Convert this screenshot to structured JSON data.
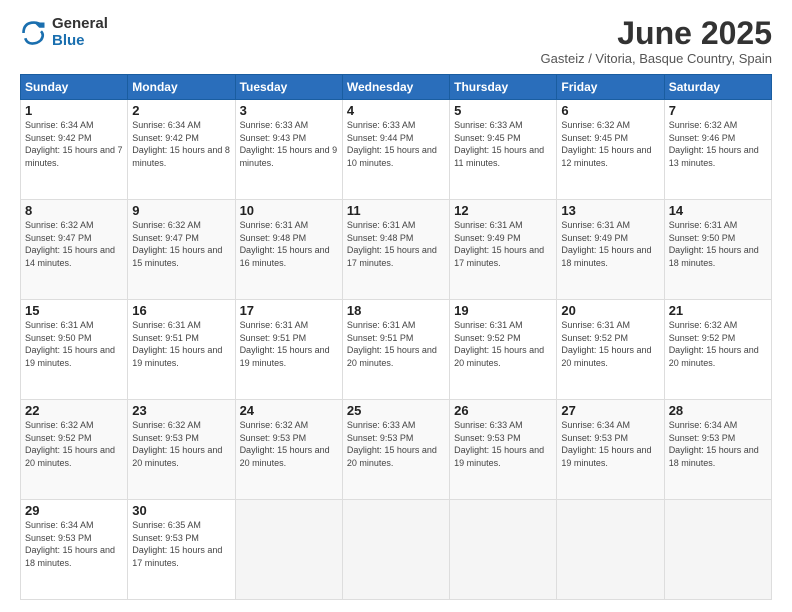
{
  "logo": {
    "general": "General",
    "blue": "Blue"
  },
  "title": {
    "month": "June 2025",
    "location": "Gasteiz / Vitoria, Basque Country, Spain"
  },
  "days_of_week": [
    "Sunday",
    "Monday",
    "Tuesday",
    "Wednesday",
    "Thursday",
    "Friday",
    "Saturday"
  ],
  "weeks": [
    [
      {
        "day": "1",
        "sunrise": "6:34 AM",
        "sunset": "9:42 PM",
        "daylight": "15 hours and 7 minutes."
      },
      {
        "day": "2",
        "sunrise": "6:34 AM",
        "sunset": "9:42 PM",
        "daylight": "15 hours and 8 minutes."
      },
      {
        "day": "3",
        "sunrise": "6:33 AM",
        "sunset": "9:43 PM",
        "daylight": "15 hours and 9 minutes."
      },
      {
        "day": "4",
        "sunrise": "6:33 AM",
        "sunset": "9:44 PM",
        "daylight": "15 hours and 10 minutes."
      },
      {
        "day": "5",
        "sunrise": "6:33 AM",
        "sunset": "9:45 PM",
        "daylight": "15 hours and 11 minutes."
      },
      {
        "day": "6",
        "sunrise": "6:32 AM",
        "sunset": "9:45 PM",
        "daylight": "15 hours and 12 minutes."
      },
      {
        "day": "7",
        "sunrise": "6:32 AM",
        "sunset": "9:46 PM",
        "daylight": "15 hours and 13 minutes."
      }
    ],
    [
      {
        "day": "8",
        "sunrise": "6:32 AM",
        "sunset": "9:47 PM",
        "daylight": "15 hours and 14 minutes."
      },
      {
        "day": "9",
        "sunrise": "6:32 AM",
        "sunset": "9:47 PM",
        "daylight": "15 hours and 15 minutes."
      },
      {
        "day": "10",
        "sunrise": "6:31 AM",
        "sunset": "9:48 PM",
        "daylight": "15 hours and 16 minutes."
      },
      {
        "day": "11",
        "sunrise": "6:31 AM",
        "sunset": "9:48 PM",
        "daylight": "15 hours and 17 minutes."
      },
      {
        "day": "12",
        "sunrise": "6:31 AM",
        "sunset": "9:49 PM",
        "daylight": "15 hours and 17 minutes."
      },
      {
        "day": "13",
        "sunrise": "6:31 AM",
        "sunset": "9:49 PM",
        "daylight": "15 hours and 18 minutes."
      },
      {
        "day": "14",
        "sunrise": "6:31 AM",
        "sunset": "9:50 PM",
        "daylight": "15 hours and 18 minutes."
      }
    ],
    [
      {
        "day": "15",
        "sunrise": "6:31 AM",
        "sunset": "9:50 PM",
        "daylight": "15 hours and 19 minutes."
      },
      {
        "day": "16",
        "sunrise": "6:31 AM",
        "sunset": "9:51 PM",
        "daylight": "15 hours and 19 minutes."
      },
      {
        "day": "17",
        "sunrise": "6:31 AM",
        "sunset": "9:51 PM",
        "daylight": "15 hours and 19 minutes."
      },
      {
        "day": "18",
        "sunrise": "6:31 AM",
        "sunset": "9:51 PM",
        "daylight": "15 hours and 20 minutes."
      },
      {
        "day": "19",
        "sunrise": "6:31 AM",
        "sunset": "9:52 PM",
        "daylight": "15 hours and 20 minutes."
      },
      {
        "day": "20",
        "sunrise": "6:31 AM",
        "sunset": "9:52 PM",
        "daylight": "15 hours and 20 minutes."
      },
      {
        "day": "21",
        "sunrise": "6:32 AM",
        "sunset": "9:52 PM",
        "daylight": "15 hours and 20 minutes."
      }
    ],
    [
      {
        "day": "22",
        "sunrise": "6:32 AM",
        "sunset": "9:52 PM",
        "daylight": "15 hours and 20 minutes."
      },
      {
        "day": "23",
        "sunrise": "6:32 AM",
        "sunset": "9:53 PM",
        "daylight": "15 hours and 20 minutes."
      },
      {
        "day": "24",
        "sunrise": "6:32 AM",
        "sunset": "9:53 PM",
        "daylight": "15 hours and 20 minutes."
      },
      {
        "day": "25",
        "sunrise": "6:33 AM",
        "sunset": "9:53 PM",
        "daylight": "15 hours and 20 minutes."
      },
      {
        "day": "26",
        "sunrise": "6:33 AM",
        "sunset": "9:53 PM",
        "daylight": "15 hours and 19 minutes."
      },
      {
        "day": "27",
        "sunrise": "6:34 AM",
        "sunset": "9:53 PM",
        "daylight": "15 hours and 19 minutes."
      },
      {
        "day": "28",
        "sunrise": "6:34 AM",
        "sunset": "9:53 PM",
        "daylight": "15 hours and 18 minutes."
      }
    ],
    [
      {
        "day": "29",
        "sunrise": "6:34 AM",
        "sunset": "9:53 PM",
        "daylight": "15 hours and 18 minutes."
      },
      {
        "day": "30",
        "sunrise": "6:35 AM",
        "sunset": "9:53 PM",
        "daylight": "15 hours and 17 minutes."
      },
      null,
      null,
      null,
      null,
      null
    ]
  ],
  "labels": {
    "sunrise": "Sunrise:",
    "sunset": "Sunset:",
    "daylight": "Daylight:"
  }
}
